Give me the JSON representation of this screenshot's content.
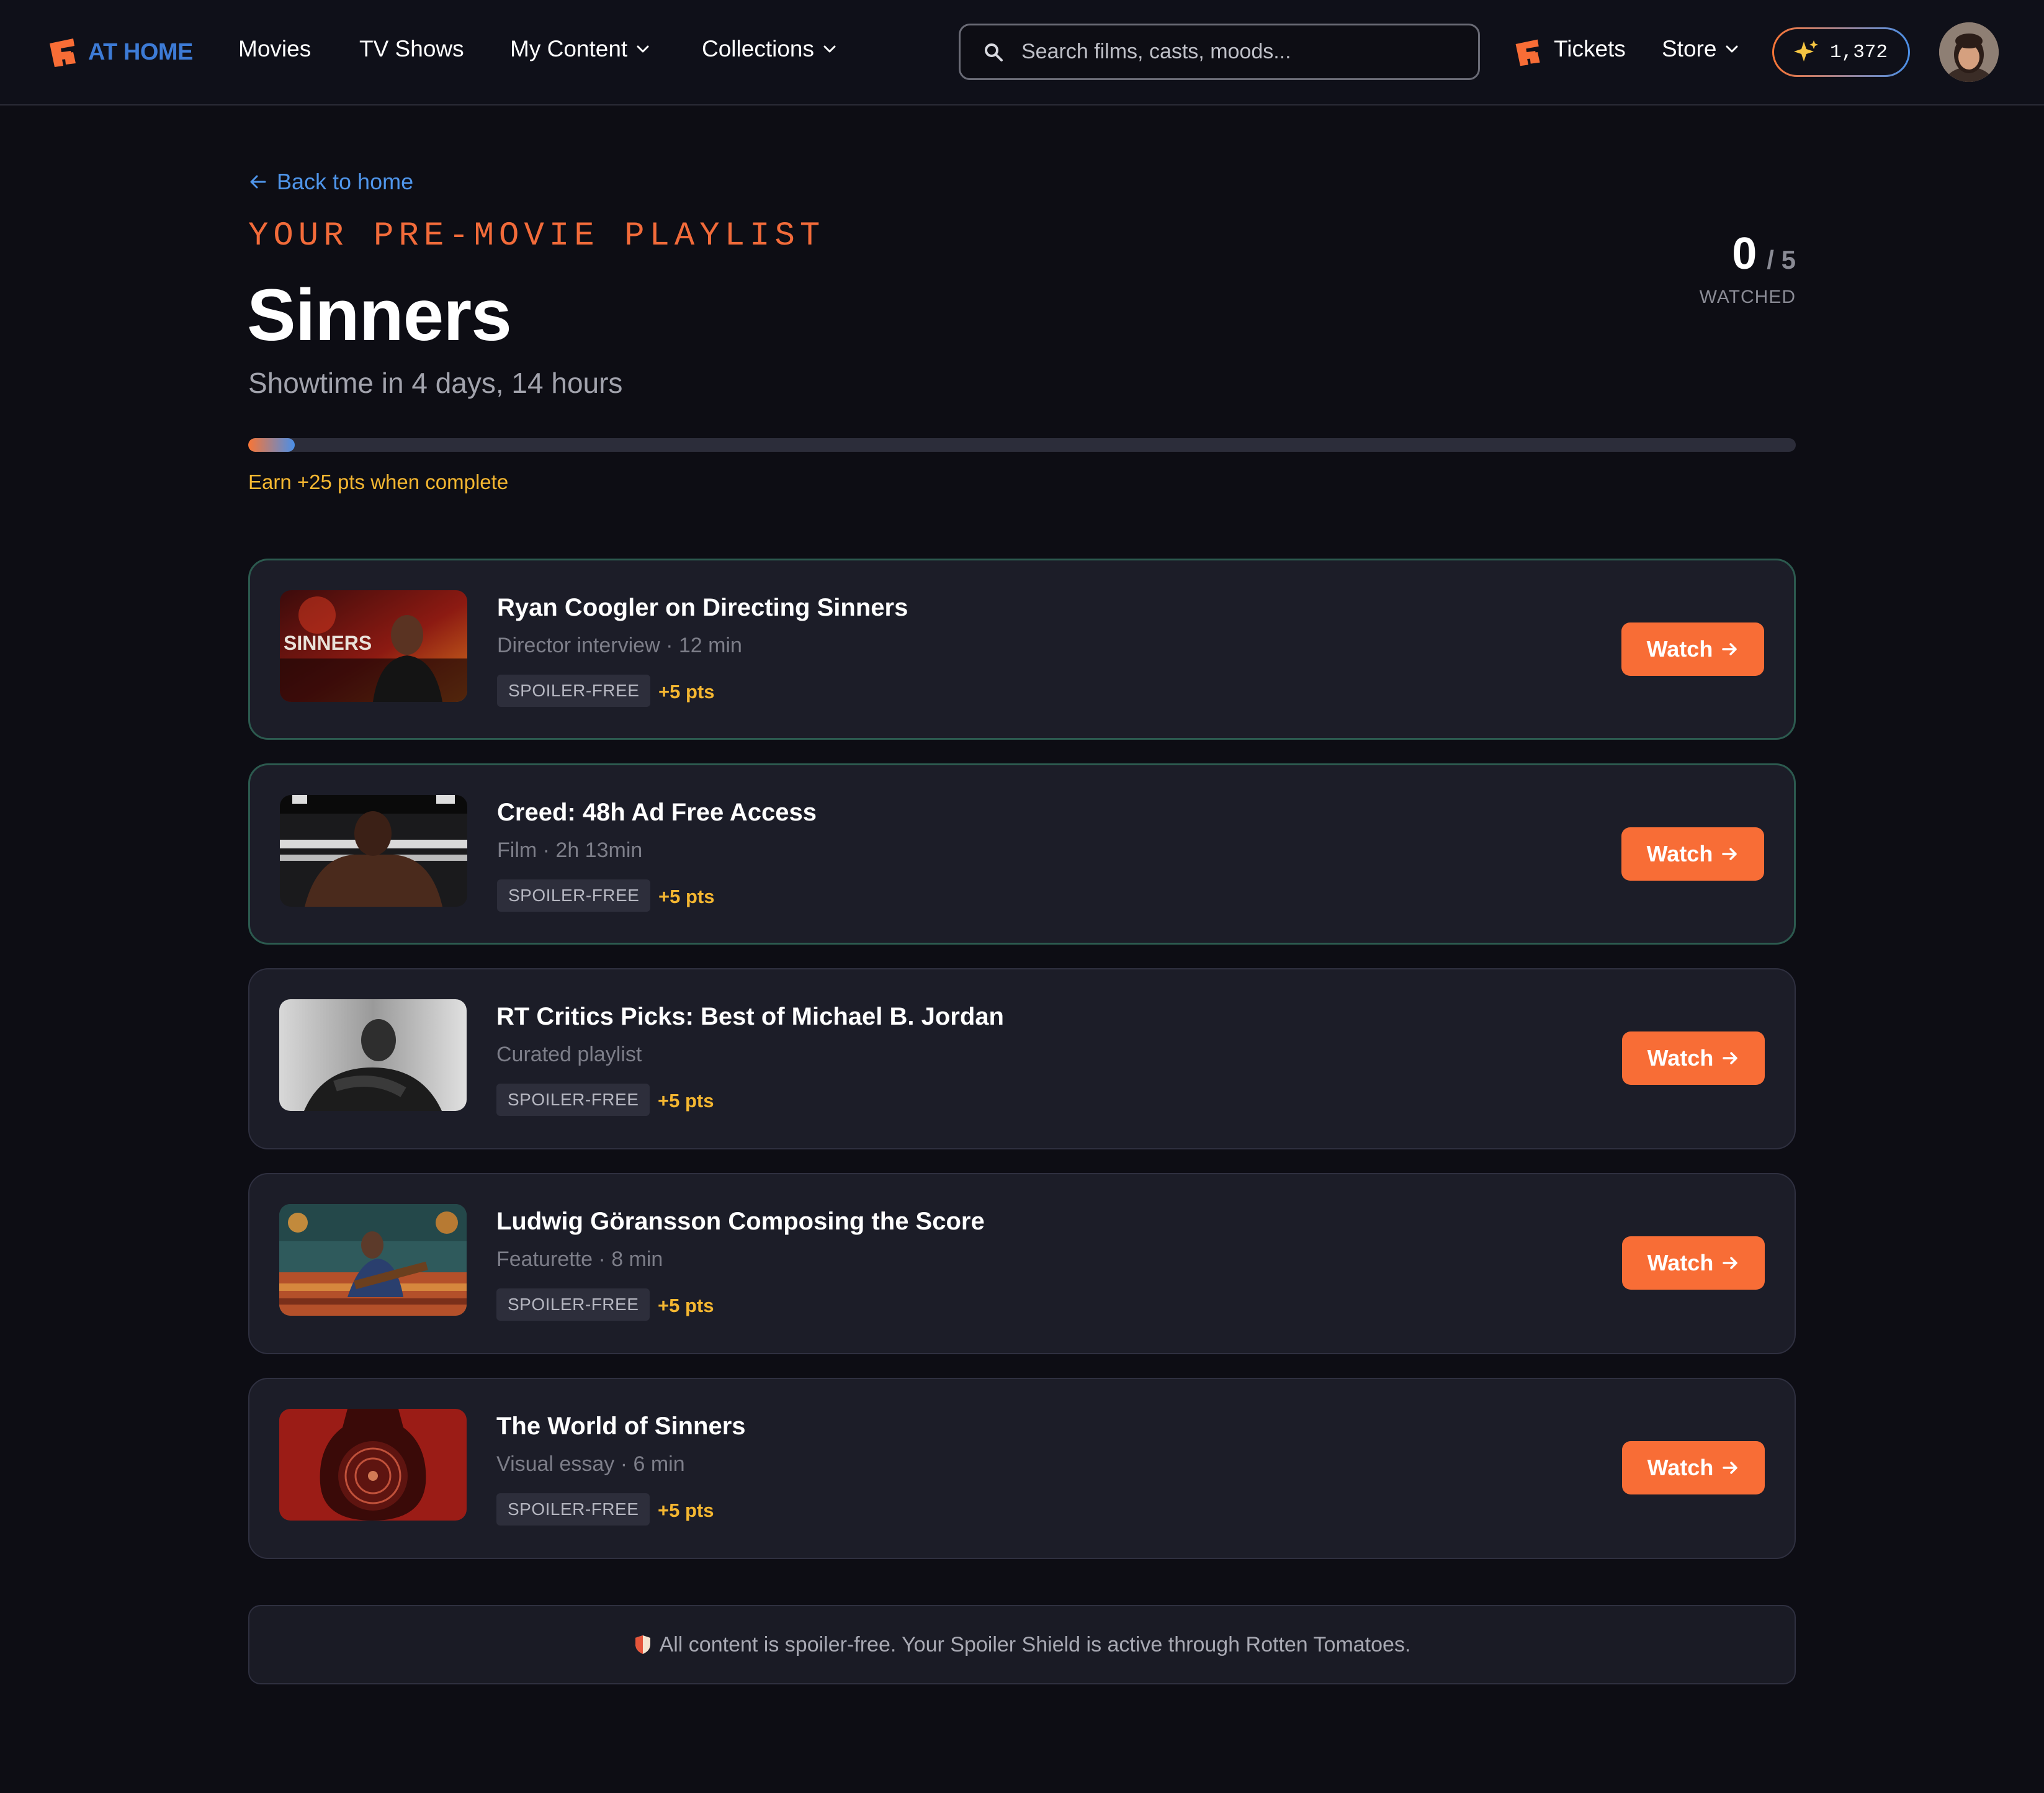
{
  "brand": {
    "name": "AT HOME",
    "accent": "#f86d36",
    "link": "#4f95ea",
    "highlight": "#f5b731"
  },
  "nav": {
    "movies": "Movies",
    "tv_shows": "TV Shows",
    "my_content": "My Content",
    "collections": "Collections",
    "tickets": "Tickets",
    "store": "Store"
  },
  "search": {
    "placeholder": "Search films, casts, moods..."
  },
  "points": {
    "balance": "1,372"
  },
  "page": {
    "back_label": "Back to home",
    "eyebrow": "YOUR PRE-MOVIE PLAYLIST",
    "title": "Sinners",
    "subtitle": "Showtime in 4 days, 14 hours",
    "watched_count": "0",
    "watched_total": "/ 5",
    "watched_label": "WATCHED",
    "progress_fraction": 0.03,
    "earn_note": "Earn +25 pts when complete"
  },
  "playlist": [
    {
      "title": "Ryan Coogler on Directing Sinners",
      "meta": "Director interview · 12 min",
      "badge": "SPOILER-FREE",
      "points": "+5 pts",
      "button": "Watch",
      "thumb_icon": "sinners-interview-thumb",
      "thumb_text": "SINNERS"
    },
    {
      "title": "Creed: 48h Ad Free Access",
      "meta": "Film · 2h 13min",
      "badge": "SPOILER-FREE",
      "points": "+5 pts",
      "button": "Watch",
      "thumb_icon": "boxer-thumb"
    },
    {
      "title": "RT Critics Picks: Best of Michael B. Jordan",
      "meta": "Curated playlist",
      "badge": "SPOILER-FREE",
      "points": "+5 pts",
      "button": "Watch",
      "thumb_icon": "portrait-bw-thumb"
    },
    {
      "title": "Ludwig Göransson Composing the Score",
      "meta": "Featurette · 8 min",
      "badge": "SPOILER-FREE",
      "points": "+5 pts",
      "button": "Watch",
      "thumb_icon": "guitarist-thumb"
    },
    {
      "title": "The World of Sinners",
      "meta": "Visual essay · 6 min",
      "badge": "SPOILER-FREE",
      "points": "+5 pts",
      "button": "Watch",
      "thumb_icon": "resonator-guitar-thumb"
    }
  ],
  "footer": {
    "note": "All content is spoiler-free. Your Spoiler Shield is active through Rotten Tomatoes."
  }
}
